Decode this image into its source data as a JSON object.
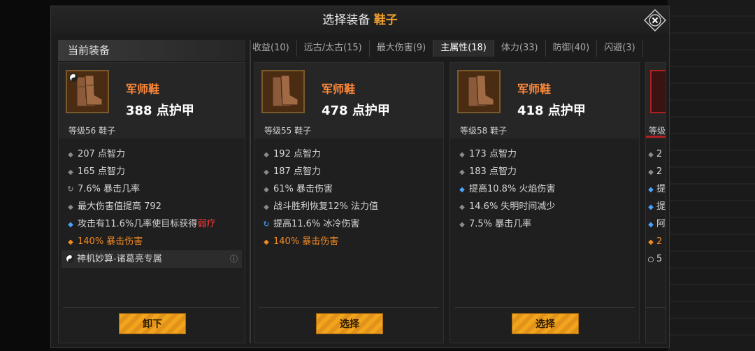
{
  "title": {
    "prefix": "选择装备",
    "slot": "鞋子"
  },
  "current_header": "当前装备",
  "tabs": [
    {
      "label": "收益(10)",
      "active": false
    },
    {
      "label": "远古/太古(15)",
      "active": false
    },
    {
      "label": "最大伤害(9)",
      "active": false
    },
    {
      "label": "主属性(18)",
      "active": true
    },
    {
      "label": "体力(33)",
      "active": false
    },
    {
      "label": "防御(40)",
      "active": false
    },
    {
      "label": "闪避(3)",
      "active": false
    }
  ],
  "current": {
    "name": "军师鞋",
    "armor": "388 点护甲",
    "level": "等级56 鞋子",
    "stats": {
      "s1": "207 点智力",
      "s2": "165 点智力",
      "s3": "7.6% 暴击几率",
      "s4": "最大伤害值提高 792",
      "s5a": "攻击有11.6%几率使目标获得",
      "s5b": "弱疗",
      "s6": "140% 暴击伤害",
      "set": "神机妙算-诸葛亮专属"
    },
    "button": "卸下"
  },
  "option1": {
    "name": "军师鞋",
    "armor": "478 点护甲",
    "level": "等级55 鞋子",
    "stats": [
      "192 点智力",
      "187 点智力",
      "61% 暴击伤害",
      "战斗胜利恢复12% 法力值",
      "提高11.6% 冰冷伤害",
      "140% 暴击伤害"
    ],
    "button": "选择"
  },
  "option2": {
    "name": "军师鞋",
    "armor": "418 点护甲",
    "level": "等级58 鞋子",
    "stats": [
      "173 点智力",
      "183 点智力",
      "提高10.8% 火焰伤害",
      "14.6% 失明时间减少",
      "7.5% 暴击几率"
    ],
    "button": "选择"
  },
  "option3_partial": {
    "level": "等级",
    "stats": [
      "2",
      "2",
      "提",
      "提",
      "阿",
      "2",
      "5"
    ]
  },
  "colors": {
    "accent": "#f0a030",
    "item_name": "#ff8a3a",
    "button": "#f2a41c"
  },
  "icons": {
    "close": "close-x-icon",
    "set": "yin-yang-icon",
    "info": "info-icon",
    "item": "boots-icon"
  }
}
